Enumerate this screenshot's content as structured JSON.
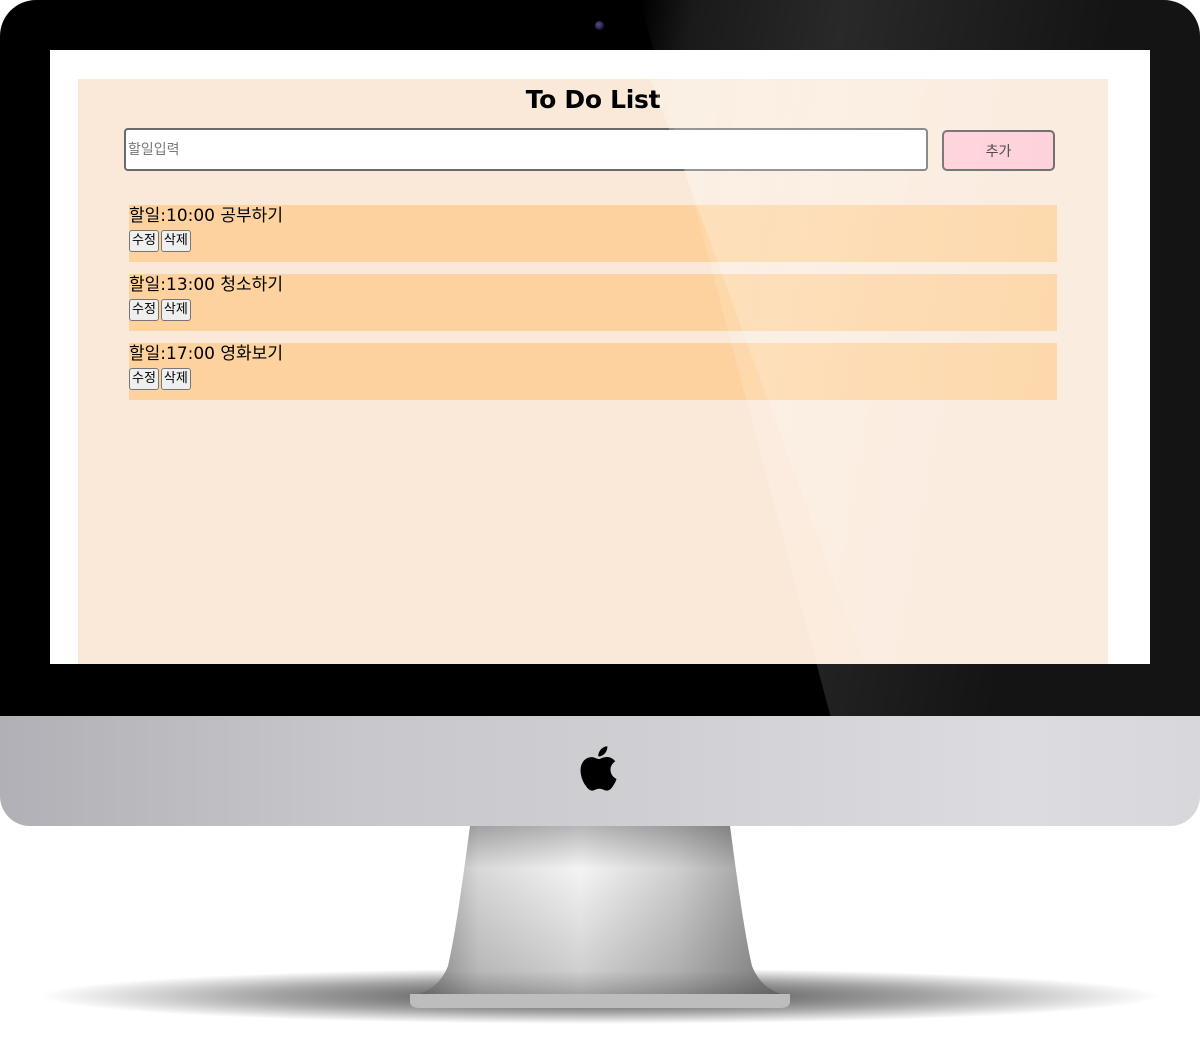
{
  "app": {
    "title": "To Do List",
    "input": {
      "placeholder": "할일입력",
      "value": ""
    },
    "add_button_label": "추가"
  },
  "todos": [
    {
      "text": "할일:10:00 공부하기",
      "edit_label": "수정",
      "delete_label": "삭제"
    },
    {
      "text": "할일:13:00 청소하기",
      "edit_label": "수정",
      "delete_label": "삭제"
    },
    {
      "text": "할일:17:00 영화보기",
      "edit_label": "수정",
      "delete_label": "삭제"
    }
  ],
  "colors": {
    "app_background": "#fae9d9",
    "todo_item_background": "#fdd29e",
    "add_button_background": "#ffc9d3",
    "bezel": "#000000"
  },
  "icons": [
    "apple-logo-icon",
    "camera-icon"
  ]
}
